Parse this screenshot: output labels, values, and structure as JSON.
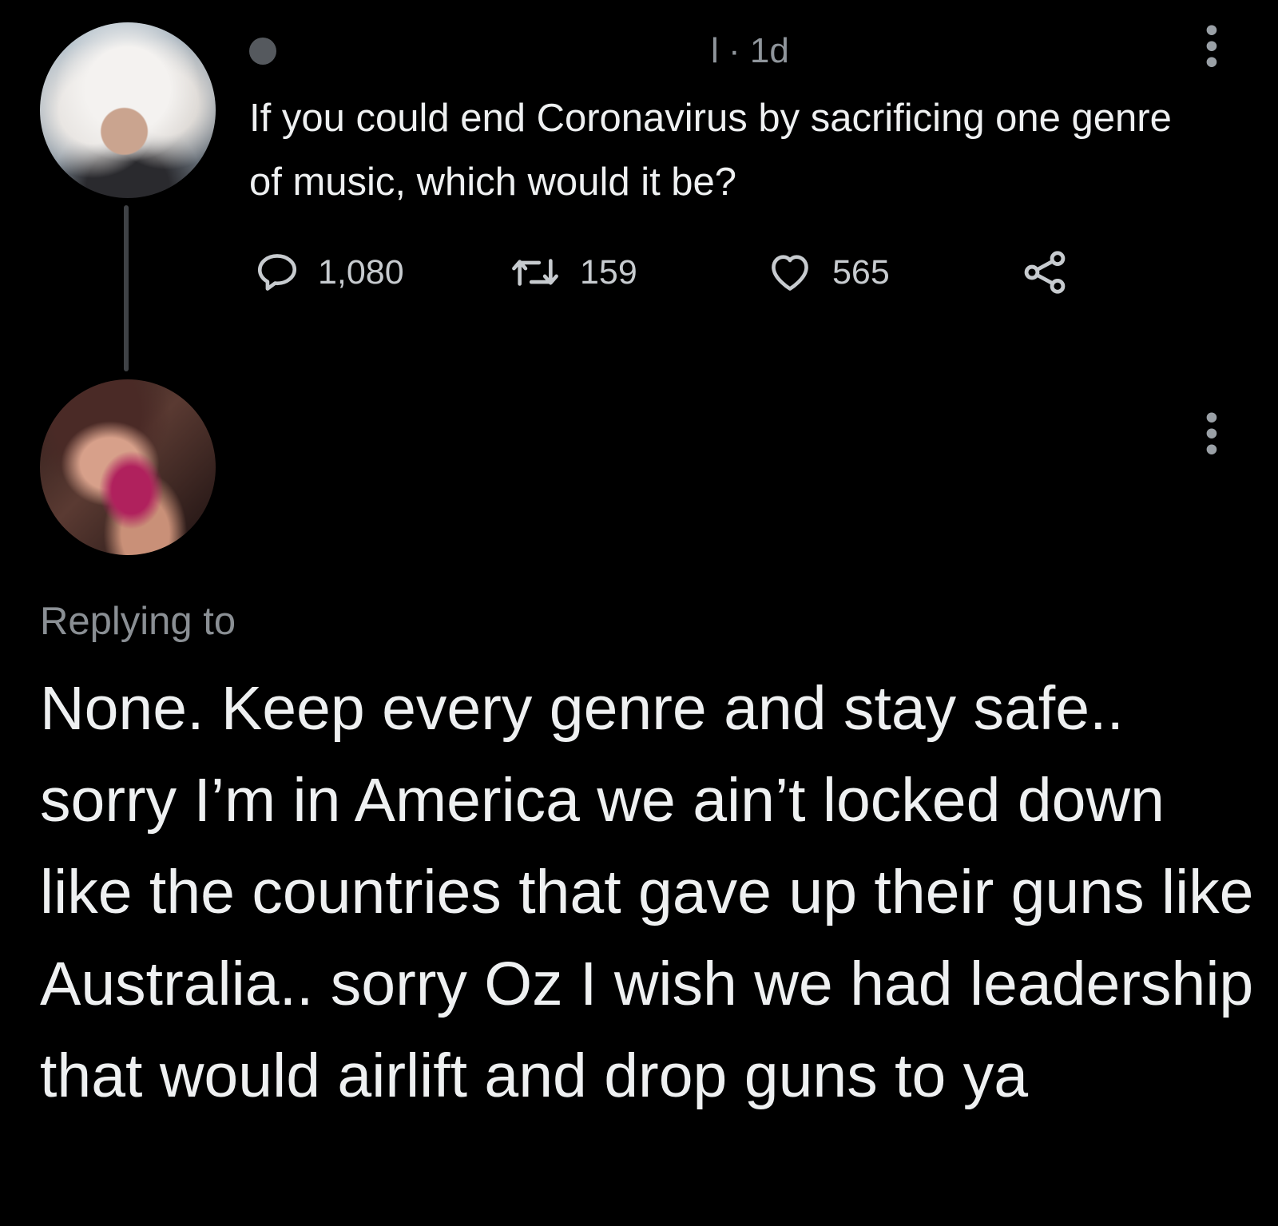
{
  "original_tweet": {
    "timestamp": "l · 1d",
    "text": "If you could end Coronavirus by sacrificing one genre of music, which would it be?",
    "actions": {
      "reply_count": "1,080",
      "retweet_count": "159",
      "like_count": "565"
    },
    "icons": {
      "reply": "reply-icon",
      "retweet": "retweet-icon",
      "like": "heart-icon",
      "share": "share-icon",
      "more": "more-options-icon"
    }
  },
  "reply_tweet": {
    "replying_to_label": "Replying to",
    "text": "None. Keep every genre and stay safe.. sorry I’m in America we ain’t locked down like the countries that gave up their guns like Australia.. sorry Oz I wish we had leadership that would airlift and drop guns to ya"
  },
  "colors": {
    "background": "#000000",
    "text_primary": "#eef0f1",
    "text_secondary": "#8a8f94",
    "thread_line": "#3f4246"
  }
}
